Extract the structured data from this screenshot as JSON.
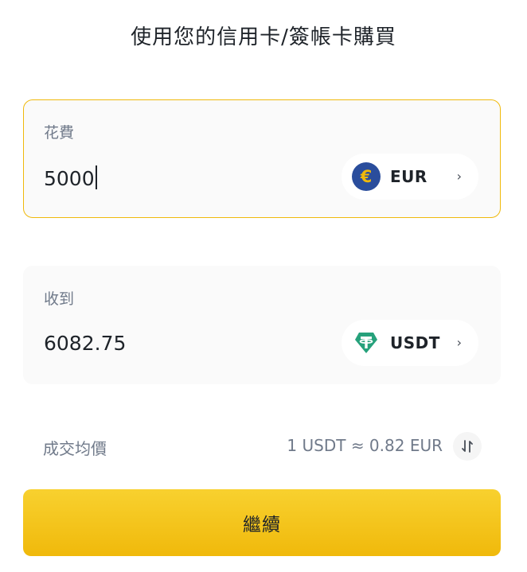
{
  "header": {
    "title": "使用您的信用卡/簽帳卡購買"
  },
  "spend": {
    "label": "花費",
    "value": "5000",
    "currency": {
      "code": "EUR",
      "icon": "euro-icon",
      "icon_glyph": "€",
      "icon_color": "#2a4d9c"
    }
  },
  "receive": {
    "label": "收到",
    "value": "6082.75",
    "currency": {
      "code": "USDT",
      "icon": "tether-icon",
      "icon_color": "#26a17b"
    }
  },
  "rate": {
    "label": "成交均價",
    "value": "1 USDT ≈ 0.82 EUR"
  },
  "actions": {
    "continue_label": "繼續"
  },
  "colors": {
    "accent": "#f0b90b",
    "text_primary": "#1e2329",
    "text_secondary": "#707a8a"
  }
}
